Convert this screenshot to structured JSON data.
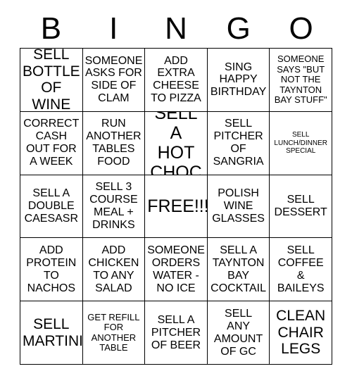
{
  "card": {
    "header_letters": [
      "B",
      "I",
      "N",
      "G",
      "O"
    ],
    "columns": 5,
    "rows": 5,
    "border_color": "#000000",
    "background_color": "#ffffff",
    "text_color": "#000000",
    "cells": [
      {
        "text": "SELL\nBOTTLE\nOF WINE",
        "size": "lg",
        "column": "B",
        "row": 1
      },
      {
        "text": "SOMEONE\nASKS FOR\nSIDE OF\nCLAM",
        "size": "md",
        "column": "I",
        "row": 1
      },
      {
        "text": "ADD\nEXTRA\nCHEESE\nTO PIZZA",
        "size": "md",
        "column": "N",
        "row": 1
      },
      {
        "text": "SING\nHAPPY\nBIRTHDAY",
        "size": "md",
        "column": "G",
        "row": 1
      },
      {
        "text": "SOMEONE\nSAYS \"BUT\nNOT THE\nTAYNTON\nBAY STUFF\"",
        "size": "sm",
        "column": "O",
        "row": 1
      },
      {
        "text": "CORRECT\nCASH\nOUT FOR\nA WEEK",
        "size": "md",
        "column": "B",
        "row": 2
      },
      {
        "text": "RUN\nANOTHER\nTABLES\nFOOD",
        "size": "md",
        "column": "I",
        "row": 2
      },
      {
        "text": "SELL A\nHOT\nCHOC",
        "size": "xl",
        "column": "N",
        "row": 2
      },
      {
        "text": "SELL\nPITCHER\nOF\nSANGRIA",
        "size": "md",
        "column": "G",
        "row": 2
      },
      {
        "text": "SELL\nLUNCH/DINNER\nSPECIAL",
        "size": "xs",
        "column": "O",
        "row": 2
      },
      {
        "text": "SELL A\nDOUBLE\nCAESASR",
        "size": "md",
        "column": "B",
        "row": 3
      },
      {
        "text": "SELL 3\nCOURSE\nMEAL +\nDRINKS",
        "size": "md",
        "column": "I",
        "row": 3
      },
      {
        "text": "FREE!!!",
        "size": "xl",
        "column": "N",
        "row": 3
      },
      {
        "text": "POLISH\nWINE\nGLASSES",
        "size": "md",
        "column": "G",
        "row": 3
      },
      {
        "text": "SELL\nDESSERT",
        "size": "md",
        "column": "O",
        "row": 3
      },
      {
        "text": "ADD\nPROTEIN\nTO\nNACHOS",
        "size": "md",
        "column": "B",
        "row": 4
      },
      {
        "text": "ADD\nCHICKEN\nTO ANY\nSALAD",
        "size": "md",
        "column": "I",
        "row": 4
      },
      {
        "text": "SOMEONE\nORDERS\nWATER -\nNO ICE",
        "size": "md",
        "column": "N",
        "row": 4
      },
      {
        "text": "SELL A\nTAYNTON\nBAY\nCOCKTAIL",
        "size": "md",
        "column": "G",
        "row": 4
      },
      {
        "text": "SELL\nCOFFEE\n&\nBAILEYS",
        "size": "md",
        "column": "O",
        "row": 4
      },
      {
        "text": "SELL\nMARTINI",
        "size": "lg",
        "column": "B",
        "row": 5
      },
      {
        "text": "GET REFILL\nFOR\nANOTHER\nTABLE",
        "size": "sm",
        "column": "I",
        "row": 5
      },
      {
        "text": "SELL A\nPITCHER\nOF BEER",
        "size": "md",
        "column": "N",
        "row": 5
      },
      {
        "text": "SELL\nANY\nAMOUNT\nOF GC",
        "size": "md",
        "column": "G",
        "row": 5
      },
      {
        "text": "CLEAN\nCHAIR\nLEGS",
        "size": "lg",
        "column": "O",
        "row": 5
      }
    ]
  }
}
